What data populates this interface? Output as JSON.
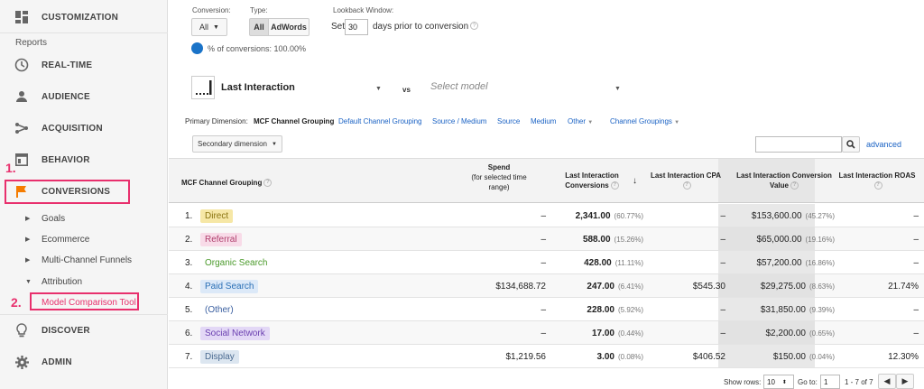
{
  "sidebar": {
    "customization": "CUSTOMIZATION",
    "reports_header": "Reports",
    "realtime": "REAL-TIME",
    "audience": "AUDIENCE",
    "acquisition": "ACQUISITION",
    "behavior": "BEHAVIOR",
    "conversions": "CONVERSIONS",
    "goals": "Goals",
    "ecommerce": "Ecommerce",
    "mcf": "Multi-Channel Funnels",
    "attribution": "Attribution",
    "model_comparison": "Model Comparison Tool",
    "discover": "DISCOVER",
    "admin": "ADMIN",
    "annotation_1": "1.",
    "annotation_2": "2."
  },
  "controls": {
    "conversion_label": "Conversion:",
    "conversion_value": "All",
    "type_label": "Type:",
    "type_all": "All",
    "type_adwords": "AdWords",
    "lookback_label": "Lookback Window:",
    "lookback_set": "Set",
    "lookback_days": "30",
    "lookback_suffix": "days prior to conversion",
    "pct_conversions": "% of conversions: 100.00%",
    "model_name": "Last Interaction",
    "vs": "vs",
    "select_model": "Select model",
    "primary_dimension_label": "Primary Dimension:",
    "dim_active": "MCF Channel Grouping",
    "dim_default": "Default Channel Grouping",
    "dim_source_medium": "Source / Medium",
    "dim_source": "Source",
    "dim_medium": "Medium",
    "dim_other": "Other",
    "dim_channel_groupings": "Channel Groupings",
    "secondary_dimension": "Secondary dimension",
    "advanced": "advanced"
  },
  "table": {
    "headers": {
      "channel": "MCF Channel Grouping",
      "spend_1": "Spend",
      "spend_2": "(for selected time",
      "spend_3": "range)",
      "conv_1": "Last Interaction",
      "conv_2": "Conversions",
      "cpa": "Last Interaction CPA",
      "value_1": "Last Interaction Conversion",
      "value_2": "Value",
      "roas": "Last Interaction ROAS"
    },
    "rows": [
      {
        "num": "1.",
        "channel": "Direct",
        "color": "#f6e7a6",
        "text_color": "#8a7410",
        "spend": "–",
        "conv": "2,341.00",
        "conv_pct": "(60.77%)",
        "cpa": "–",
        "value": "$153,600.00",
        "value_pct": "(45.27%)",
        "roas": "–"
      },
      {
        "num": "2.",
        "channel": "Referral",
        "color": "#f8dbe8",
        "text_color": "#b0406e",
        "spend": "–",
        "conv": "588.00",
        "conv_pct": "(15.26%)",
        "cpa": "–",
        "value": "$65,000.00",
        "value_pct": "(19.16%)",
        "roas": "–"
      },
      {
        "num": "3.",
        "channel": "Organic Search",
        "color": "transparent",
        "text_color": "#4a9a2a",
        "spend": "–",
        "conv": "428.00",
        "conv_pct": "(11.11%)",
        "cpa": "–",
        "value": "$57,200.00",
        "value_pct": "(16.86%)",
        "roas": "–"
      },
      {
        "num": "4.",
        "channel": "Paid Search",
        "color": "#dce9f8",
        "text_color": "#2a6fb5",
        "spend": "$134,688.72",
        "conv": "247.00",
        "conv_pct": "(6.41%)",
        "cpa": "$545.30",
        "value": "$29,275.00",
        "value_pct": "(8.63%)",
        "roas": "21.74%"
      },
      {
        "num": "5.",
        "channel": "(Other)",
        "color": "transparent",
        "text_color": "#3a5fa0",
        "spend": "–",
        "conv": "228.00",
        "conv_pct": "(5.92%)",
        "cpa": "–",
        "value": "$31,850.00",
        "value_pct": "(9.39%)",
        "roas": "–"
      },
      {
        "num": "6.",
        "channel": "Social Network",
        "color": "#e3d8f6",
        "text_color": "#6a3fb0",
        "spend": "–",
        "conv": "17.00",
        "conv_pct": "(0.44%)",
        "cpa": "–",
        "value": "$2,200.00",
        "value_pct": "(0.65%)",
        "roas": "–"
      },
      {
        "num": "7.",
        "channel": "Display",
        "color": "#dce6f0",
        "text_color": "#4a6a90",
        "spend": "$1,219.56",
        "conv": "3.00",
        "conv_pct": "(0.08%)",
        "cpa": "$406.52",
        "value": "$150.00",
        "value_pct": "(0.04%)",
        "roas": "12.30%"
      }
    ]
  },
  "footer": {
    "show_rows_label": "Show rows:",
    "show_rows_value": "10",
    "goto_label": "Go to:",
    "goto_value": "1",
    "range": "1 - 7 of 7"
  },
  "colors": {
    "accent_pink": "#e8306d",
    "link_blue": "#1a62c4",
    "orange_flag": "#f57c00"
  }
}
